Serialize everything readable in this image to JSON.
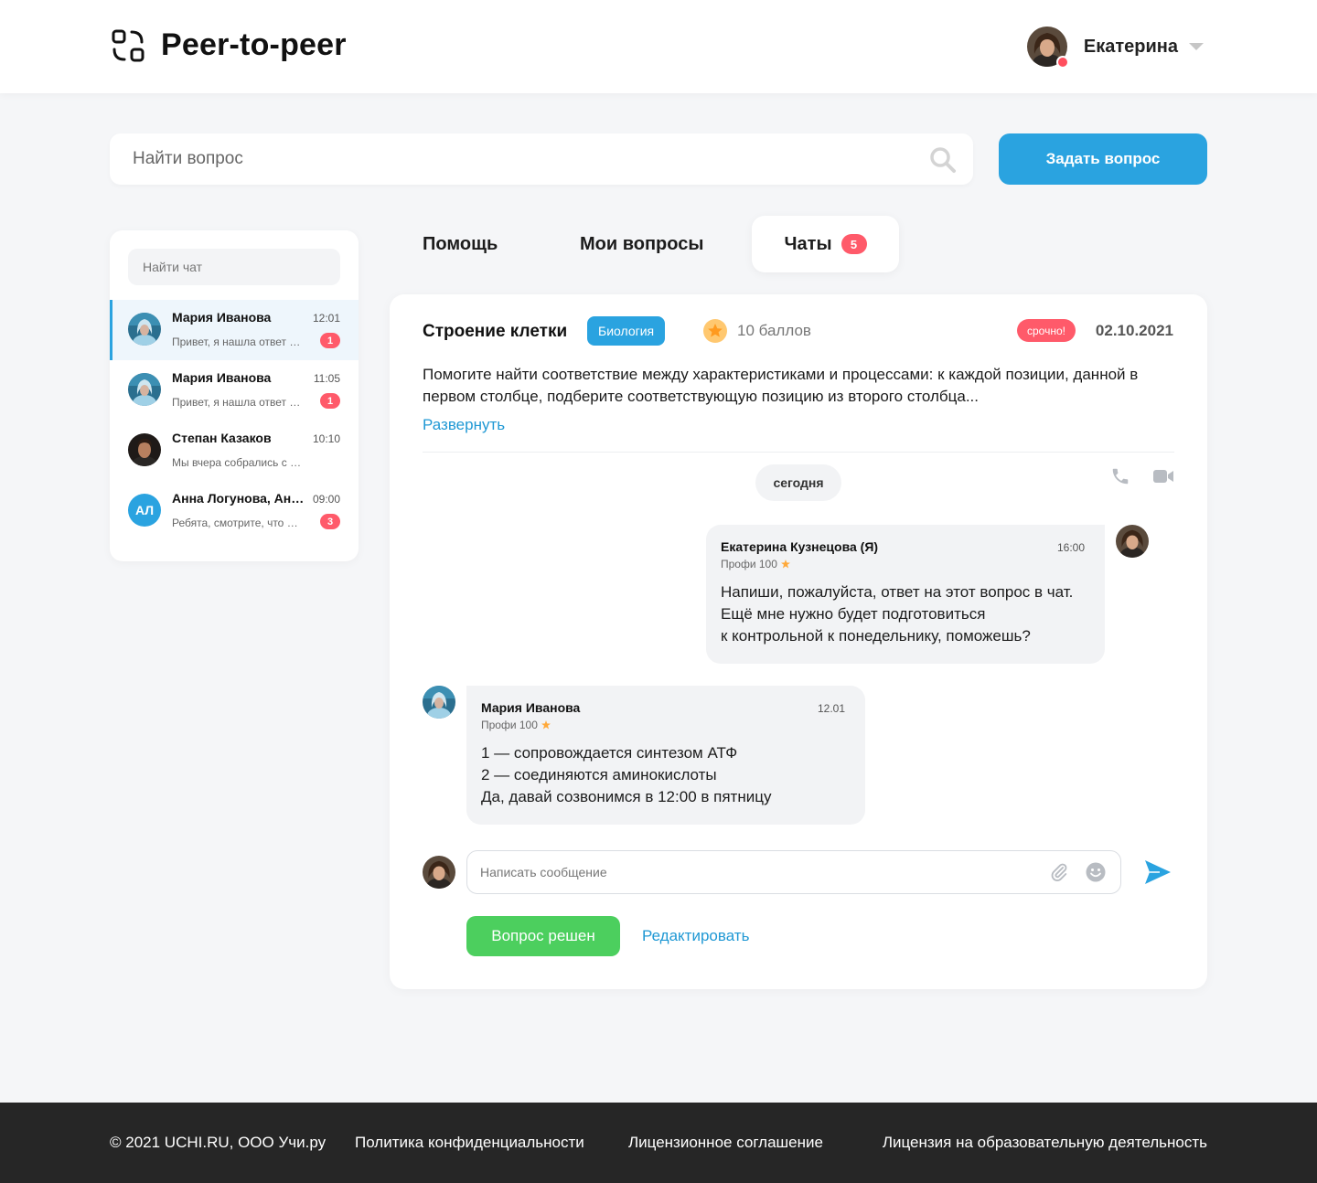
{
  "header": {
    "app_title": "Peer-to-peer",
    "user_name": "Екатерина"
  },
  "search": {
    "placeholder": "Найти вопрос",
    "ask_button": "Задать вопрос"
  },
  "chat_list": {
    "search_placeholder": "Найти чат",
    "items": [
      {
        "name": "Мария Иванова",
        "time": "12:01",
        "preview": "Привет, я нашла ответ на вопрос",
        "badge": "1",
        "avatar": "photo-blue",
        "active": true
      },
      {
        "name": "Мария Иванова",
        "time": "11:05",
        "preview": "Привет, я нашла ответ на вопрос",
        "badge": "1",
        "avatar": "photo-blue",
        "active": false
      },
      {
        "name": "Степан Казаков",
        "time": "10:10",
        "preview": "Мы вчера собрались с группой",
        "badge": "",
        "avatar": "photo-dark",
        "active": false
      },
      {
        "name": "Анна Логунова, Андрей",
        "time": "09:00",
        "preview": "Ребята, смотрите, что я нашла",
        "badge": "3",
        "avatar": "initials",
        "initials": "АЛ",
        "active": false
      }
    ]
  },
  "tabs": [
    {
      "label": "Помощь",
      "active": false
    },
    {
      "label": "Мои вопросы",
      "active": false
    },
    {
      "label": "Чаты",
      "active": true,
      "badge": "5"
    }
  ],
  "question": {
    "title": "Строение клетки",
    "subject": "Биология",
    "points": "10 баллов",
    "urgent": "срочно!",
    "date": "02.10.2021",
    "text": "Помогите найти соответствие между характеристиками и процессами: к каждой позиции, данной в первом столбце, подберите соответствующую позицию из второго столбца...",
    "expand_label": "Развернуть"
  },
  "chat": {
    "day_label": "сегодня",
    "messages": [
      {
        "author": "Екатерина Кузнецова (Я)",
        "time": "16:00",
        "rank": "Профи 100",
        "lines": [
          "Напиши, пожалуйста, ответ на этот вопрос в чат.",
          "Ещё мне нужно будет подготовиться",
          "к контрольной к понедельнику, поможешь?"
        ]
      },
      {
        "author": "Мария Иванова",
        "time": "12.01",
        "rank": "Профи 100",
        "lines": [
          "1 — сопровождается синтезом АТФ",
          "2 — соединяются аминокислоты",
          "Да, давай созвонимся в 12:00 в пятницу"
        ]
      }
    ],
    "compose_placeholder": "Написать сообщение",
    "solved_button": "Вопрос решен",
    "edit_link": "Редактировать"
  },
  "footer": {
    "copyright": "© 2021 UCHI.RU, ООО Учи.ру",
    "links": [
      "Политика конфиденциальности",
      "Лицензионное соглашение",
      "Лицензия на образовательную деятельность"
    ]
  },
  "colors": {
    "accent": "#2aa3e0",
    "badge": "#ff5a6a",
    "success": "#4ccf5e",
    "footer_bg": "#262626",
    "page_bg": "#f5f6f8"
  },
  "icons": [
    "logo-icon",
    "search-icon",
    "chevron-down-icon",
    "star-icon",
    "phone-icon",
    "video-icon",
    "paperclip-icon",
    "smile-icon",
    "send-icon"
  ]
}
